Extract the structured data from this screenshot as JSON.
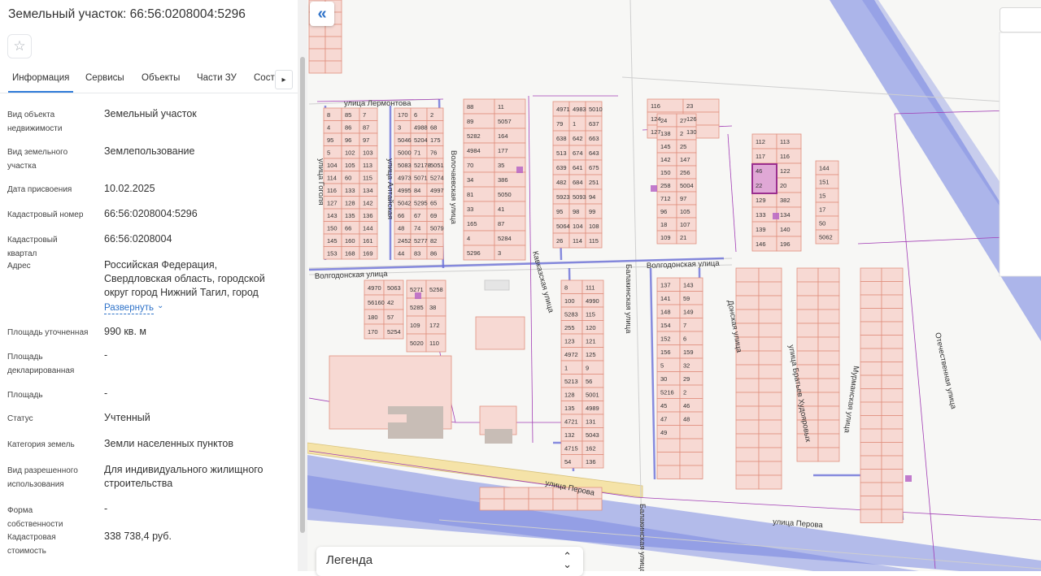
{
  "panel": {
    "title": "Земельный участок: 66:56:0208004:5296",
    "favorite_icon": "star-icon",
    "tabs": [
      "Информация",
      "Сервисы",
      "Объекты",
      "Части ЗУ",
      "Соста"
    ],
    "active_tab": "Информация",
    "rows": [
      {
        "label": "Вид объекта недвижимости",
        "value": "Земельный участок"
      },
      {
        "label": "Вид земельного участка",
        "value": "Землепользование"
      },
      {
        "label": "Дата присвоения",
        "value": "10.02.2025"
      },
      {
        "label": "Кадастровый номер",
        "value": "66:56:0208004:5296"
      },
      {
        "label": "Кадастровый квартал",
        "value": "66:56:0208004"
      },
      {
        "label": "Адрес",
        "value": "Российская Федерация, Свердловская область, городской округ город Нижний Тагил, город"
      },
      {
        "label": "Площадь уточненная",
        "value": "990 кв. м"
      },
      {
        "label": "Площадь декларированная",
        "value": "-"
      },
      {
        "label": "Площадь",
        "value": "-"
      },
      {
        "label": "Статус",
        "value": "Учтенный"
      },
      {
        "label": "Категория земель",
        "value": "Земли населенных пунктов"
      },
      {
        "label": "Вид разрешенного использования",
        "value": "Для индивидуального жилищного строительства"
      },
      {
        "label": "Форма собственности",
        "value": "-"
      },
      {
        "label": "Кадастровая стоимость",
        "value": "338 738,4 руб."
      }
    ],
    "expand_link": "Развернуть"
  },
  "map": {
    "collapse_icon": "double-chevron-left-icon",
    "legend_label": "Легенда",
    "legend_icon": "chevron-up-down-icon",
    "selected_parcel": "5296",
    "colors": {
      "parcel_fill": "#f7d9d3",
      "parcel_stroke": "#e08f7f",
      "boundary": "#a23db5",
      "zone": "#6f7fe0",
      "road": "#f5e3a8"
    },
    "streets": [
      "улица Лермонтова",
      "Волгодонская улица",
      "улица Перова",
      "Балакинская улица",
      "Волочаевская улица",
      "Кавказская улица",
      "улица Алтайская",
      "улица Гоголя",
      "Донская улица",
      "улица Братьев Худояровых",
      "Мурманская улица",
      "Отечественная улица"
    ],
    "parcel_numbers": [
      "8",
      "85",
      "7",
      "4",
      "86",
      "87",
      "95",
      "96",
      "97",
      "5",
      "102",
      "103",
      "104",
      "105",
      "113",
      "114",
      "60",
      "115",
      "116",
      "133",
      "134",
      "127",
      "128",
      "142",
      "143",
      "135",
      "136",
      "150",
      "66",
      "144",
      "145",
      "160",
      "161",
      "153",
      "168",
      "169",
      "170",
      "6",
      "2",
      "3",
      "4988",
      "68",
      "5046",
      "5204",
      "175",
      "5000",
      "71",
      "76",
      "5083",
      "52178",
      "5051",
      "4973",
      "5071",
      "5274",
      "4995",
      "84",
      "4997",
      "5042",
      "5295",
      "65",
      "66",
      "67",
      "69",
      "48",
      "74",
      "5079",
      "2452",
      "5277",
      "82",
      "44",
      "83",
      "86",
      "88",
      "11",
      "89",
      "5057",
      "5282",
      "164",
      "4984",
      "177",
      "70",
      "35",
      "34",
      "386",
      "81",
      "5050",
      "33",
      "41",
      "165",
      "87",
      "4",
      "5284",
      "5296",
      "3",
      "4971",
      "4983",
      "5010",
      "79",
      "1",
      "637",
      "638",
      "642",
      "663",
      "513",
      "674",
      "643",
      "639",
      "641",
      "675",
      "482",
      "684",
      "251",
      "5923",
      "5093",
      "94",
      "95",
      "98",
      "99",
      "5064",
      "104",
      "108",
      "26",
      "114",
      "115",
      "116",
      "23",
      "124",
      "126",
      "127",
      "130",
      "24",
      "27",
      "138",
      "2",
      "145",
      "25",
      "142",
      "147",
      "150",
      "256",
      "258",
      "5004",
      "712",
      "97",
      "96",
      "105",
      "18",
      "107",
      "109",
      "21",
      "112",
      "113",
      "117",
      "116",
      "46",
      "122",
      "22",
      "20",
      "129",
      "382",
      "133",
      "134",
      "139",
      "140",
      "146",
      "196",
      "144",
      "151",
      "15",
      "17",
      "50",
      "5062",
      "4970",
      "5063",
      "56160",
      "42",
      "180",
      "57",
      "170",
      "5254",
      "5271",
      "5258",
      "5285",
      "38",
      "109",
      "172",
      "5020",
      "110",
      "8",
      "111",
      "100",
      "4990",
      "5283",
      "115",
      "255",
      "120",
      "123",
      "121",
      "4972",
      "125",
      "1",
      "9",
      "5213",
      "56",
      "128",
      "5001",
      "135",
      "4989",
      "4721",
      "131",
      "132",
      "5043",
      "4715",
      "162",
      "54",
      "136",
      "137",
      "143",
      "141",
      "59",
      "148",
      "149",
      "154",
      "7",
      "152",
      "6",
      "156",
      "159",
      "5",
      "32",
      "30",
      "29",
      "5216",
      "2",
      "45",
      "46",
      "47",
      "48",
      "49"
    ]
  }
}
